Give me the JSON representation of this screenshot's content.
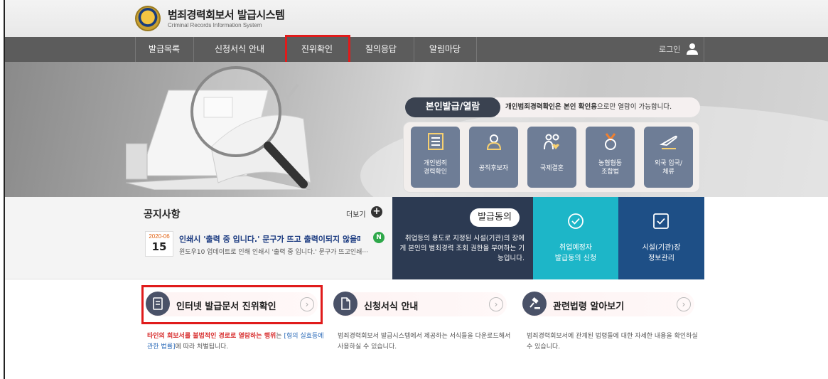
{
  "header": {
    "title": "범죄경력회보서 발급시스템",
    "subtitle": "Criminal Records Information System"
  },
  "nav": {
    "items": [
      "발급목록",
      "신청서식 안내",
      "진위확인",
      "질의응답",
      "알림마당"
    ],
    "login": "로그인"
  },
  "hero": {
    "pill_title": "본인발급/열람",
    "pill_desc_bold": "개인범죄경력확인은 본인 확인용",
    "pill_desc_rest": "으로만 열람이 가능합니다.",
    "services": [
      {
        "label1": "개인범죄",
        "label2": "경력확인",
        "icon": "document-icon"
      },
      {
        "label1": "공직후보자",
        "label2": "",
        "icon": "candidate-icon"
      },
      {
        "label1": "국제결혼",
        "label2": "",
        "icon": "couple-icon"
      },
      {
        "label1": "농협협동",
        "label2": "조합법",
        "icon": "medal-icon"
      },
      {
        "label1": "외국 입국/",
        "label2": "체류",
        "icon": "airplane-icon"
      }
    ]
  },
  "notice": {
    "title": "공지사항",
    "more": "더보기",
    "date_ym": "2020-06",
    "date_d": "15",
    "headline": "인쇄시 '출력 중 입니다.' 문구가 뜨고 출력이되지 않을때 ···",
    "badge": "N",
    "body": "윈도우10 업데이트로 인해 인쇄시 '출력 중 입니다.' 문구가 뜨고인쇄···"
  },
  "consent": {
    "button": "발급동의",
    "text": "취업등의 용도로 지정된 시설(기관)의 장에게 본인의 범죄경력 조회 권한을 부여하는 기능입니다."
  },
  "tiles": {
    "prospect_line1": "취업예정자",
    "prospect_line2": "발급동의 신청",
    "facility_line1": "시설(기관)장",
    "facility_line2": "정보관리"
  },
  "cards": [
    {
      "label": "인터넷 발급문서 진위확인",
      "desc_red": "타인의 회보서를 불법적인 경로로 열람하는 행위",
      "desc_mid": "는 ",
      "desc_blue": "[형의 실효등에 관한 법률]",
      "desc_end": "에 따라 처벌됩니다."
    },
    {
      "label": "신청서식 안내",
      "desc": "범죄경력회보서 발급시스템에서 제공하는 서식들을 다운로드해서 사용하실 수 있습니다."
    },
    {
      "label": "관련법령 알아보기",
      "desc": "범죄경력회보서에 관계된 법령들에 대한 자세한 내용을 확인하실 수 있습니다."
    }
  ],
  "colors": {
    "nav_bg": "#5c5c5c",
    "highlight": "#e01b1b",
    "consent_bg": "#2c3a52",
    "prospect_bg": "#1db6c8",
    "facility_bg": "#1e4f86"
  }
}
